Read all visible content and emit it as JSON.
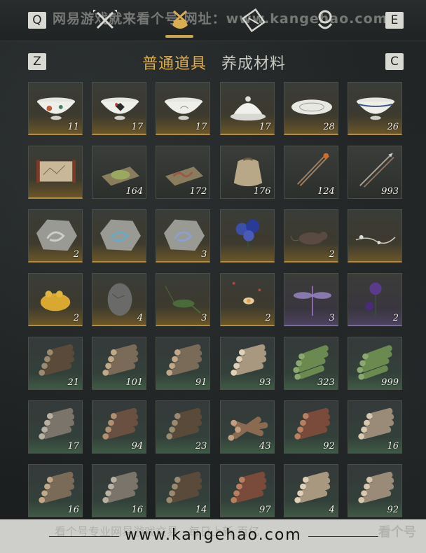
{
  "header": {
    "key_left": "Q",
    "key_right": "E",
    "watermark": "网易游戏就来看个号 网址：www.kangehao.com",
    "nav_icons": [
      "swords-icon",
      "bag-icon",
      "scroll-icon",
      "map-pin-icon"
    ]
  },
  "tabs": {
    "key_left": "Z",
    "key_right": "C",
    "items": [
      {
        "label": "普通道具",
        "active": true
      },
      {
        "label": "养成材料",
        "active": false
      }
    ]
  },
  "inventory": [
    {
      "icon": "porcelain-bowl-flowers-icon",
      "count": "11",
      "rarity": "gold"
    },
    {
      "icon": "porcelain-bowl-rooster-icon",
      "count": "17",
      "rarity": "gold"
    },
    {
      "icon": "porcelain-bowl-white-icon",
      "count": "17",
      "rarity": "gold"
    },
    {
      "icon": "lidded-bowl-icon",
      "count": "17",
      "rarity": "gold"
    },
    {
      "icon": "porcelain-plate-icon",
      "count": "28",
      "rarity": "gold"
    },
    {
      "icon": "porcelain-bowl-blue-rim-icon",
      "count": "26",
      "rarity": "gold"
    },
    {
      "icon": "scroll-painting-icon",
      "count": "",
      "rarity": "gold"
    },
    {
      "icon": "green-powder-icon",
      "count": "164",
      "rarity": "normal"
    },
    {
      "icon": "earthworm-icon",
      "count": "172",
      "rarity": "normal"
    },
    {
      "icon": "cloth-sack-icon",
      "count": "176",
      "rarity": "normal"
    },
    {
      "icon": "fire-arrow-icon",
      "count": "124",
      "rarity": "normal"
    },
    {
      "icon": "arrows-icon",
      "count": "993",
      "rarity": "normal"
    },
    {
      "icon": "fossil-stone-deer-icon",
      "count": "2",
      "rarity": "gold"
    },
    {
      "icon": "fossil-stone-phoenix-icon",
      "count": "",
      "rarity": "gold"
    },
    {
      "icon": "fossil-stone-dragon-icon",
      "count": "3",
      "rarity": "gold"
    },
    {
      "icon": "blue-flower-icon",
      "count": "",
      "rarity": "gold"
    },
    {
      "icon": "rat-icon",
      "count": "2",
      "rarity": "gold"
    },
    {
      "icon": "white-branch-icon",
      "count": "",
      "rarity": "gold"
    },
    {
      "icon": "golden-toad-icon",
      "count": "2",
      "rarity": "gold"
    },
    {
      "icon": "stone-egg-icon",
      "count": "4",
      "rarity": "gold"
    },
    {
      "icon": "cricket-icon",
      "count": "3",
      "rarity": "gold"
    },
    {
      "icon": "fireflies-icon",
      "count": "2",
      "rarity": "gold"
    },
    {
      "icon": "purple-dragonfly-icon",
      "count": "3",
      "rarity": "purple"
    },
    {
      "icon": "purple-thistle-icon",
      "count": "2",
      "rarity": "purple"
    },
    {
      "icon": "log-bundle-dark-icon",
      "count": "21",
      "rarity": "green"
    },
    {
      "icon": "log-bundle-icon",
      "count": "101",
      "rarity": "green"
    },
    {
      "icon": "log-pile-icon",
      "count": "91",
      "rarity": "green"
    },
    {
      "icon": "log-pile-light-icon",
      "count": "93",
      "rarity": "green"
    },
    {
      "icon": "bamboo-pile-icon",
      "count": "323",
      "rarity": "green"
    },
    {
      "icon": "bamboo-bundle-icon",
      "count": "999",
      "rarity": "green"
    },
    {
      "icon": "log-pile-gray-icon",
      "count": "17",
      "rarity": "green"
    },
    {
      "icon": "log-pile-brown-icon",
      "count": "94",
      "rarity": "green"
    },
    {
      "icon": "log-pile-dark-icon",
      "count": "23",
      "rarity": "green"
    },
    {
      "icon": "log-cross-icon",
      "count": "43",
      "rarity": "green"
    },
    {
      "icon": "log-pile-red-icon",
      "count": "92",
      "rarity": "green"
    },
    {
      "icon": "log-pile-pale-icon",
      "count": "16",
      "rarity": "green"
    },
    {
      "icon": "log-stack-icon",
      "count": "16",
      "rarity": "green"
    },
    {
      "icon": "log-stack-gray-icon",
      "count": "16",
      "rarity": "green"
    },
    {
      "icon": "log-stack-dark-icon",
      "count": "14",
      "rarity": "green"
    },
    {
      "icon": "log-stack-red-icon",
      "count": "97",
      "rarity": "green"
    },
    {
      "icon": "log-stack-light-icon",
      "count": "4",
      "rarity": "green"
    },
    {
      "icon": "log-stack-pale-icon",
      "count": "92",
      "rarity": "green"
    }
  ],
  "footer": {
    "watermark_faint": "看个号专业网易游戏交易 · 每日上新 百亿",
    "url": "www.kangehao.com",
    "logo": "看个号"
  },
  "colors": {
    "accent_gold": "#d8ad53",
    "tab_inactive": "#c9c9c3"
  }
}
